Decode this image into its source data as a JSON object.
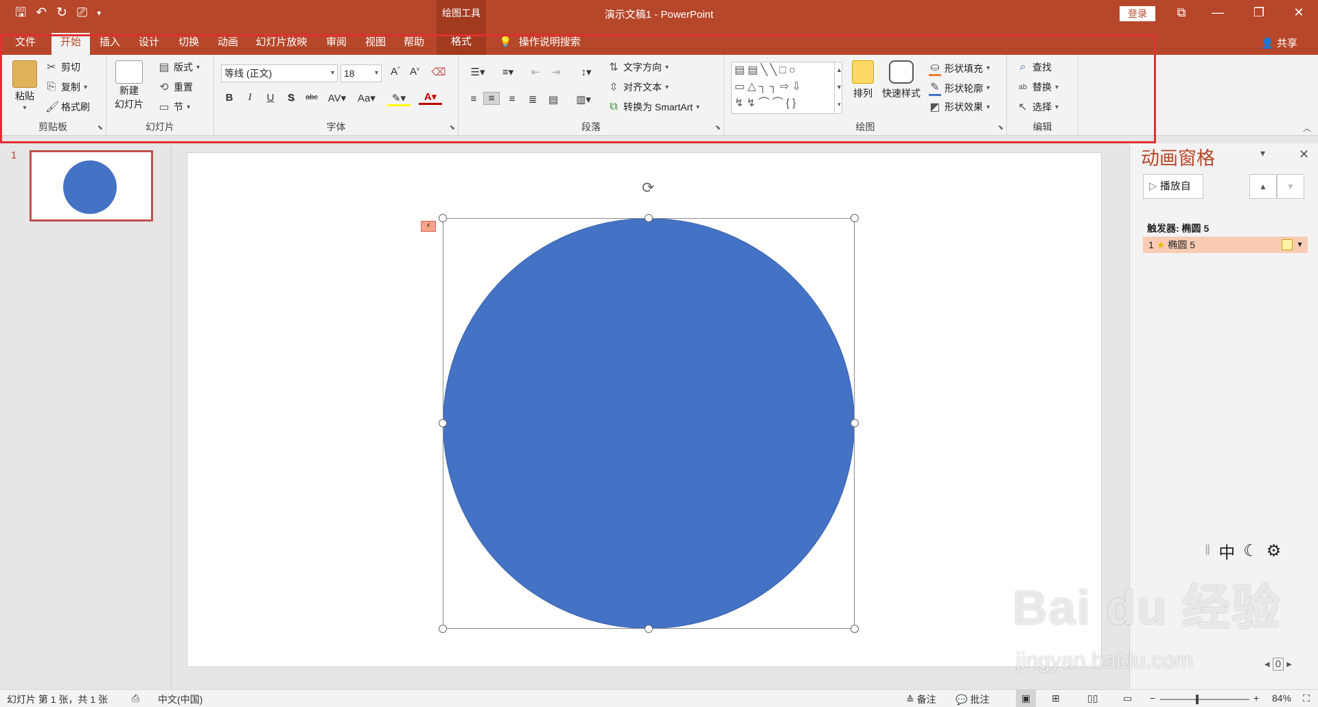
{
  "app": {
    "title": "演示文稿1  -  PowerPoint",
    "contextual_group": "绘图工具",
    "login": "登录",
    "share": "共享",
    "accent": "#b7472a"
  },
  "tabs": [
    "文件",
    "开始",
    "插入",
    "设计",
    "切换",
    "动画",
    "幻灯片放映",
    "审阅",
    "视图",
    "帮助",
    "格式"
  ],
  "active_tab": "开始",
  "tell_me": "操作说明搜索",
  "ribbon": {
    "clipboard": {
      "label": "剪贴板",
      "paste": "粘贴",
      "cut": "剪切",
      "copy": "复制",
      "painter": "格式刷"
    },
    "slides": {
      "label": "幻灯片",
      "new_slide_1": "新建",
      "new_slide_2": "幻灯片",
      "layout": "版式",
      "reset": "重置",
      "section": "节"
    },
    "font": {
      "label": "字体",
      "font_name": "等线 (正文)",
      "font_size": "18"
    },
    "paragraph": {
      "label": "段落",
      "text_direction": "文字方向",
      "align_text": "对齐文本",
      "smartart": "转换为 SmartArt"
    },
    "drawing": {
      "label": "绘图",
      "arrange": "排列",
      "quick_styles": "快速样式",
      "fill": "形状填充",
      "outline": "形状轮廓",
      "effects": "形状效果"
    },
    "editing": {
      "label": "编辑",
      "find": "查找",
      "replace": "替换",
      "select": "选择"
    }
  },
  "thumbnails": {
    "slide_number": "1"
  },
  "shape": {
    "fill": "#4472c4"
  },
  "animation_pane": {
    "title": "动画窗格",
    "play_from": "播放自",
    "trigger": "触发器: 椭圆 5",
    "item_number": "1",
    "item_name": "椭圆 5"
  },
  "ime": {
    "mode": "中"
  },
  "watermark": {
    "brand": "Bai du 经验",
    "url": "jingyan.baidu.com"
  },
  "pager": {
    "current": "0"
  },
  "status": {
    "slide_info": "幻灯片 第 1 张，共 1 张",
    "language": "中文(中国)",
    "notes": "备注",
    "comments": "批注",
    "zoom": "84%"
  }
}
